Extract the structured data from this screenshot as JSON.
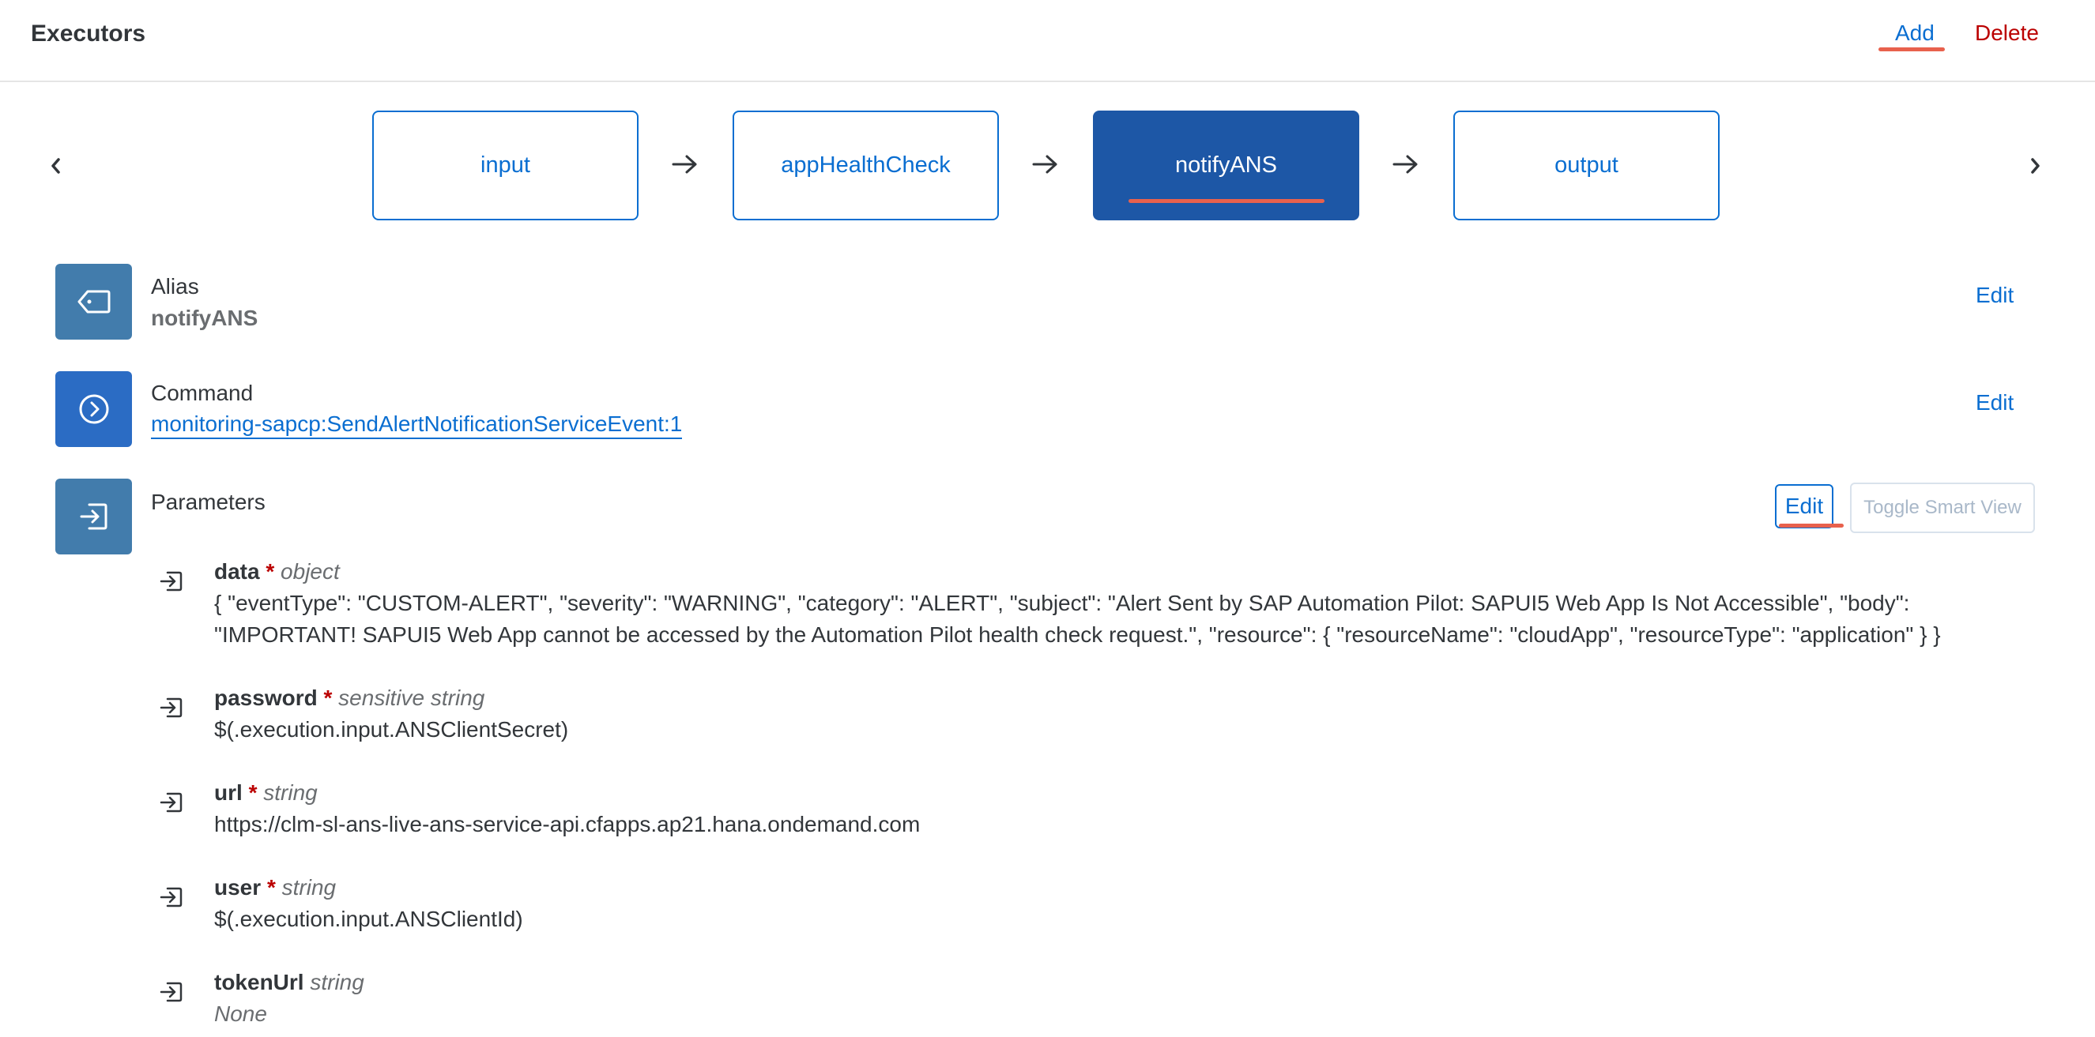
{
  "header": {
    "title": "Executors",
    "add_label": "Add",
    "delete_label": "Delete"
  },
  "flow": {
    "steps": [
      {
        "label": "input",
        "active": false
      },
      {
        "label": "appHealthCheck",
        "active": false
      },
      {
        "label": "notifyANS",
        "active": true
      },
      {
        "label": "output",
        "active": false
      }
    ]
  },
  "alias": {
    "label": "Alias",
    "value": "notifyANS",
    "edit_label": "Edit"
  },
  "command": {
    "label": "Command",
    "value": "monitoring-sapcp:SendAlertNotificationServiceEvent:1",
    "edit_label": "Edit"
  },
  "parameters": {
    "label": "Parameters",
    "edit_label": "Edit",
    "toggle_label": "Toggle Smart View",
    "items": [
      {
        "name": "data",
        "required": "*",
        "type": "object",
        "value": "{ \"eventType\": \"CUSTOM-ALERT\", \"severity\": \"WARNING\", \"category\": \"ALERT\", \"subject\": \"Alert Sent by SAP Automation Pilot: SAPUI5 Web App Is Not Accessible\", \"body\": \"IMPORTANT! SAPUI5 Web App cannot be accessed by the Automation Pilot health check request.\", \"resource\": { \"resourceName\": \"cloudApp\", \"resourceType\": \"application\" } }"
      },
      {
        "name": "password",
        "required": "*",
        "type": "sensitive string",
        "value": "$(.execution.input.ANSClientSecret)"
      },
      {
        "name": "url",
        "required": "*",
        "type": "string",
        "value": "https://clm-sl-ans-live-ans-service-api.cfapps.ap21.hana.ondemand.com"
      },
      {
        "name": "user",
        "required": "*",
        "type": "string",
        "value": "$(.execution.input.ANSClientId)"
      },
      {
        "name": "tokenUrl",
        "required": "",
        "type": "string",
        "value": "None"
      }
    ]
  },
  "colors": {
    "accent": "#0a6ed1",
    "active_step": "#1d57a6",
    "danger": "#bb0000",
    "icon_bg": "#427cac",
    "highlight": "#e8614d"
  }
}
